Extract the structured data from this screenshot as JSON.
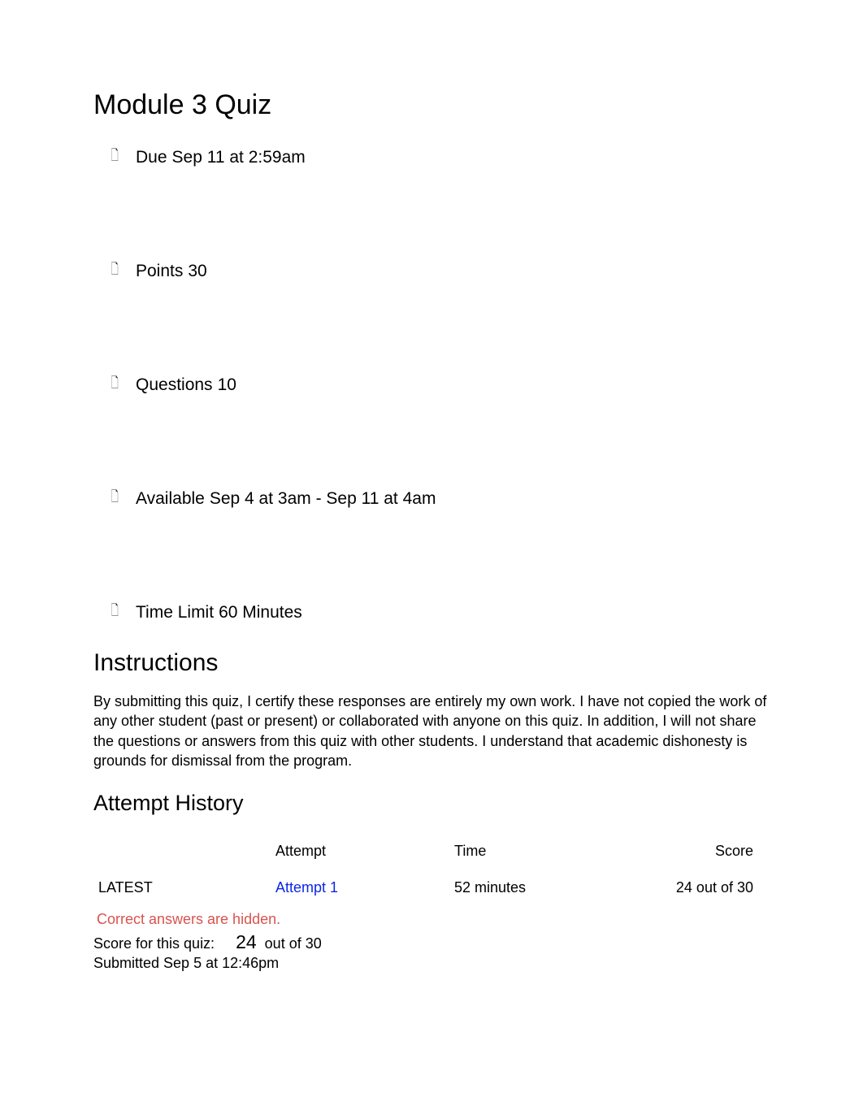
{
  "title": "Module 3 Quiz",
  "meta": {
    "due": {
      "label": "Due",
      "value": "Sep 11 at 2:59am"
    },
    "points": {
      "label": "Points",
      "value": "30"
    },
    "questions": {
      "label": "Questions",
      "value": "10"
    },
    "available": {
      "label": "Available",
      "value": "Sep 4 at 3am - Sep 11 at 4am"
    },
    "time_limit": {
      "label": "Time Limit",
      "value": "60 Minutes"
    }
  },
  "instructions": {
    "heading": "Instructions",
    "body": "By submitting this quiz, I certify these responses are entirely my own work. I have not copied the work of any other student (past or present) or collaborated with anyone on this quiz. In addition, I will not share the questions or answers from this quiz with other students. I understand that academic dishonesty is grounds for dismissal from the program."
  },
  "attempt_history": {
    "heading": "Attempt History",
    "columns": {
      "attempt": "Attempt",
      "time": "Time",
      "score": "Score"
    },
    "rows": [
      {
        "status": "LATEST",
        "attempt": "Attempt 1",
        "time": "52 minutes",
        "score": "24 out of 30"
      }
    ]
  },
  "footer": {
    "hidden": "Correct answers are hidden.",
    "score_label": "Score for this quiz:",
    "score_value": "24",
    "score_suffix": "out of 30",
    "submitted": "Submitted Sep 5 at 12:46pm"
  }
}
